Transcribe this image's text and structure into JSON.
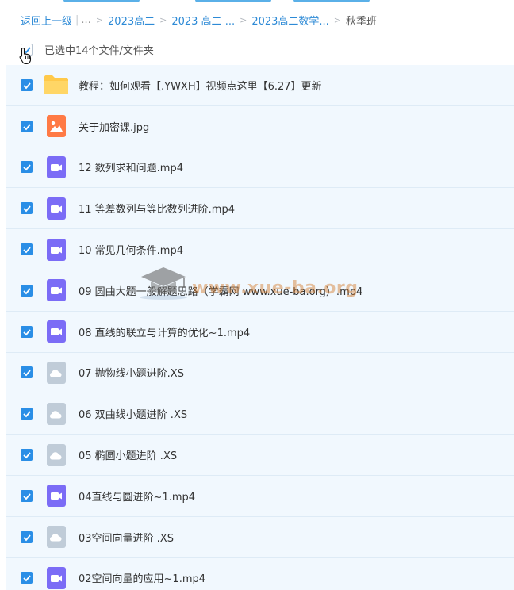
{
  "breadcrumb": {
    "back": "返回上一级",
    "ellipsis": "...",
    "items": [
      "2023高二",
      "2023 高二 ...",
      "2023高二数学..."
    ],
    "current": "秋季班"
  },
  "selection": {
    "label": "已选中14个文件/文件夹",
    "checked": true
  },
  "files": [
    {
      "name": "教程：如何观看【.YWXH】视频点这里【6.27】更新",
      "type": "folder",
      "icon": "folder-icon"
    },
    {
      "name": "关于加密课.jpg",
      "type": "image",
      "icon": "image-file-icon"
    },
    {
      "name": "12 数列求和问题.mp4",
      "type": "video",
      "icon": "video-file-icon"
    },
    {
      "name": "11 等差数列与等比数列进阶.mp4",
      "type": "video",
      "icon": "video-file-icon"
    },
    {
      "name": "10 常见几何条件.mp4",
      "type": "video",
      "icon": "video-file-icon"
    },
    {
      "name": "09 圆曲大题一般解题思路（学霸网 www.xue-ba.org）.mp4",
      "type": "video",
      "icon": "video-file-icon"
    },
    {
      "name": "08 直线的联立与计算的优化~1.mp4",
      "type": "video",
      "icon": "video-file-icon"
    },
    {
      "name": "07 抛物线小题进阶.XS",
      "type": "cloud",
      "icon": "cloud-file-icon"
    },
    {
      "name": "06 双曲线小题进阶 .XS",
      "type": "cloud",
      "icon": "cloud-file-icon"
    },
    {
      "name": "05 椭圆小题进阶 .XS",
      "type": "cloud",
      "icon": "cloud-file-icon"
    },
    {
      "name": "04直线与圆进阶~1.mp4",
      "type": "video",
      "icon": "video-file-icon"
    },
    {
      "name": "03空间向量进阶 .XS",
      "type": "cloud",
      "icon": "cloud-file-icon"
    },
    {
      "name": "02空间向量的应用~1.mp4",
      "type": "video",
      "icon": "video-file-icon"
    }
  ],
  "watermark": {
    "text": "www.xue-ba.org"
  },
  "colors": {
    "accent": "#2a8ee6",
    "link": "#2d8ad6",
    "row_bg": "#f1f8fe",
    "video": "#7b6cf6",
    "image": "#ff7a45",
    "cloud": "#c0ccd8",
    "folder": "#ffc94a"
  }
}
